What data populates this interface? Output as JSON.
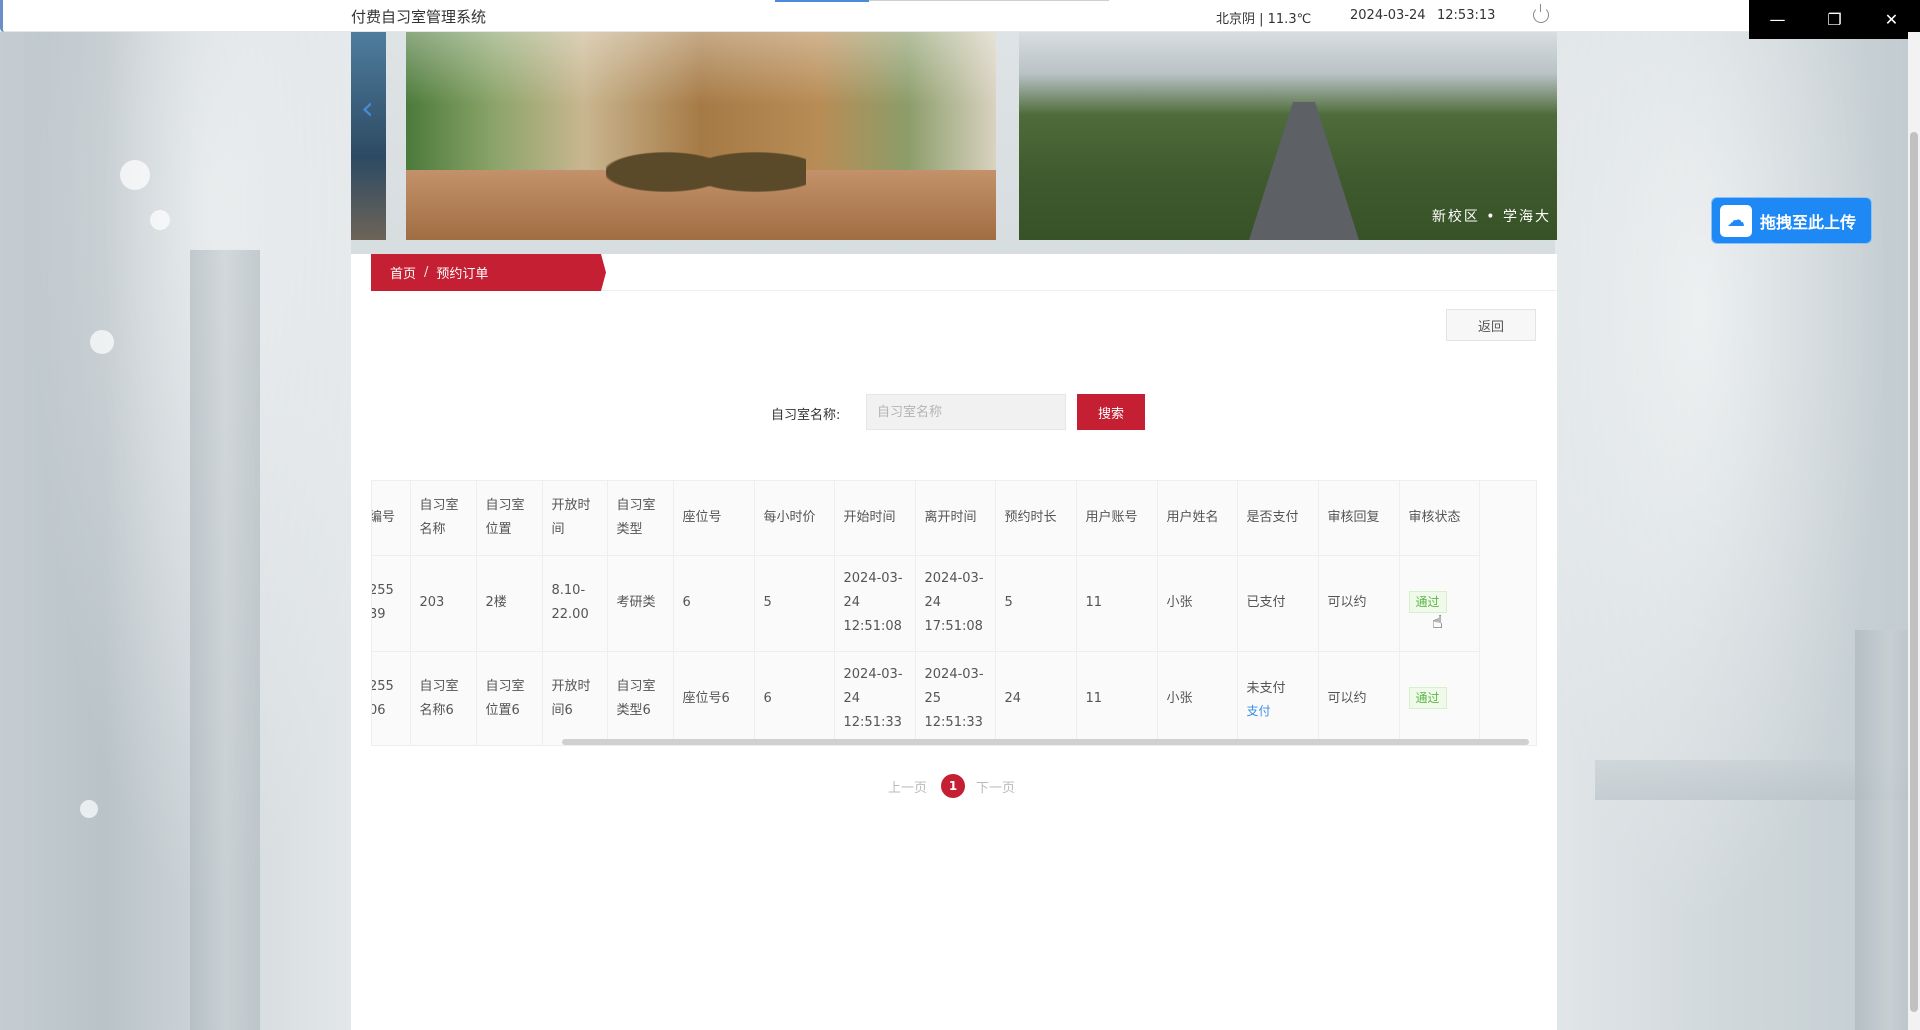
{
  "window": {
    "app_title": "付费自习室管理系统",
    "weather": "北京阴 | 11.3℃",
    "date": "2024-03-24",
    "time": "12:53:13",
    "controls": {
      "minimize": "—",
      "maximize": "❐",
      "close": "✕"
    }
  },
  "carousel": {
    "prev_arrow": "‹",
    "slide2_caption": "新校区 • 学海大"
  },
  "breadcrumb": {
    "home": "首页",
    "separator": "/",
    "current": "预约订单"
  },
  "back_button": "返回",
  "search": {
    "label": "自习室名称:",
    "placeholder": "自习室名称",
    "value": "",
    "button": "搜索"
  },
  "table": {
    "headers": [
      "编号",
      "自习室名称",
      "自习室位置",
      "开放时间",
      "自习室类型",
      "座位号",
      "每小时价",
      "开始时间",
      "离开时间",
      "预约时长",
      "用户账号",
      "用户姓名",
      "是否支付",
      "审核回复",
      "审核状态"
    ],
    "rows": [
      {
        "id": "255\n39",
        "name": "203",
        "location": "2楼",
        "open_time": "8.10-22.00",
        "type": "考研类",
        "seat": "6",
        "price": "5",
        "start": "2024-03-24 12:51:08",
        "end": "2024-03-24 17:51:08",
        "duration": "5",
        "account": "11",
        "username": "小张",
        "paid": "已支付",
        "pay_link": "",
        "reply": "可以约",
        "status": "通过"
      },
      {
        "id": "255\n06",
        "name": "自习室名称6",
        "location": "自习室位置6",
        "open_time": "开放时间6",
        "type": "自习室类型6",
        "seat": "座位号6",
        "price": "6",
        "start": "2024-03-24 12:51:33",
        "end": "2024-03-25 12:51:33",
        "duration": "24",
        "account": "11",
        "username": "小张",
        "paid": "未支付",
        "pay_link": "支付",
        "reply": "可以约",
        "status": "通过"
      }
    ]
  },
  "pager": {
    "prev": "上一页",
    "current_page": "1",
    "next": "下一页"
  },
  "upload_float": {
    "label": "拖拽至此上传",
    "icon": "cloud-upload-icon"
  },
  "colors": {
    "accent": "#c41f33",
    "upload_blue": "#1e88f5",
    "status_green": "#5ab446",
    "link_blue": "#3a8ee6"
  }
}
